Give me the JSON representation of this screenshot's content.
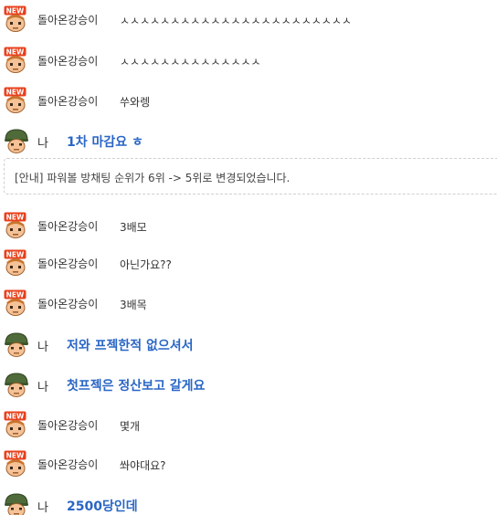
{
  "messages": [
    {
      "kind": "user",
      "badge": "NEW",
      "nick": "돌아온강승이",
      "text": "ㅅㅅㅅㅅㅅㅅㅅㅅㅅㅅㅅㅅㅅㅅㅅㅅㅅㅅㅅㅅㅅㅅㅅ"
    },
    {
      "kind": "user",
      "badge": "NEW",
      "nick": "돌아온강승이",
      "text": "ㅅㅅㅅㅅㅅㅅㅅㅅㅅㅅㅅㅅㅅㅅ"
    },
    {
      "kind": "user",
      "badge": "NEW",
      "nick": "돌아온강승이",
      "text": "쑤와렝"
    },
    {
      "kind": "me",
      "nick": "나",
      "text": "1차 마감요 ㅎ"
    },
    {
      "kind": "notice",
      "text": "[안내] 파워볼 방채팅 순위가 6위 -> 5위로 변경되었습니다."
    },
    {
      "kind": "user",
      "badge": "NEW",
      "nick": "돌아온강승이",
      "text": "3배모"
    },
    {
      "kind": "user",
      "badge": "NEW",
      "nick": "돌아온강승이",
      "text": "아닌가요??"
    },
    {
      "kind": "user",
      "badge": "NEW",
      "nick": "돌아온강승이",
      "text": "3배목"
    },
    {
      "kind": "me",
      "nick": "나",
      "text": "저와 프젝한적 없으셔서"
    },
    {
      "kind": "me",
      "nick": "나",
      "text": "첫프젝은 정산보고 갈게요"
    },
    {
      "kind": "user",
      "badge": "NEW",
      "nick": "돌아온강승이",
      "text": "몇개"
    },
    {
      "kind": "user",
      "badge": "NEW",
      "nick": "돌아온강승이",
      "text": "쏴야대요?"
    },
    {
      "kind": "me",
      "nick": "나",
      "text": "2500당인데"
    }
  ],
  "colors": {
    "my_message": "#2a66c5",
    "badge_red": "#e8401c",
    "helmet_green": "#4f6b3a"
  },
  "icons": {
    "user": "new-member-avatar-icon",
    "me": "soldier-avatar-icon"
  }
}
